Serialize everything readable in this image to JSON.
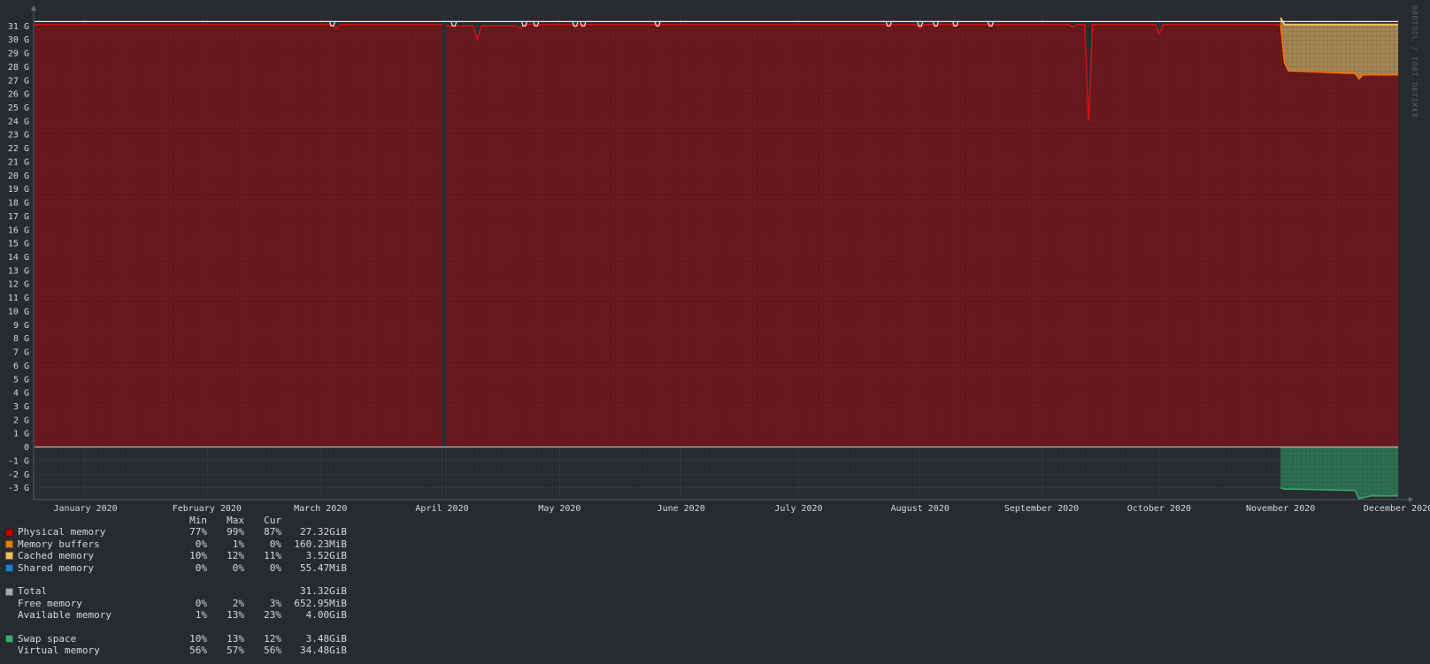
{
  "side_label": "RRDTOOL / TOBI OETIKER",
  "chart_data": {
    "type": "area",
    "title": "",
    "xlabel": "",
    "ylabel": "",
    "y_ticks": [
      "31 G",
      "30 G",
      "29 G",
      "28 G",
      "27 G",
      "26 G",
      "25 G",
      "24 G",
      "23 G",
      "22 G",
      "21 G",
      "20 G",
      "19 G",
      "18 G",
      "17 G",
      "16 G",
      "15 G",
      "14 G",
      "13 G",
      "12 G",
      "11 G",
      "10 G",
      "9 G",
      "8 G",
      "7 G",
      "6 G",
      "5 G",
      "4 G",
      "3 G",
      "2 G",
      "1 G",
      "0",
      "-1 G",
      "-2 G",
      "-3 G"
    ],
    "y_tick_values": [
      31,
      30,
      29,
      28,
      27,
      26,
      25,
      24,
      23,
      22,
      21,
      20,
      19,
      18,
      17,
      16,
      15,
      14,
      13,
      12,
      11,
      10,
      9,
      8,
      7,
      6,
      5,
      4,
      3,
      2,
      1,
      0,
      -1,
      -2,
      -3
    ],
    "ylim": [
      -3.8,
      31.8
    ],
    "x_ticks": [
      "January 2020",
      "February 2020",
      "March 2020",
      "April 2020",
      "May 2020",
      "June 2020",
      "July 2020",
      "August 2020",
      "September 2020",
      "October 2020",
      "November 2020",
      "December 2020"
    ],
    "x_tick_dates": [
      "2020-01-01",
      "2020-02-01",
      "2020-03-01",
      "2020-04-01",
      "2020-05-01",
      "2020-06-01",
      "2020-07-01",
      "2020-08-01",
      "2020-09-01",
      "2020-10-01",
      "2020-11-01",
      "2020-12-01"
    ],
    "xlim": [
      "2019-12-19",
      "2020-12-01"
    ],
    "grid": true,
    "total_gib": 31.32,
    "gap": [
      "2020-04-01",
      "2020-04-02"
    ],
    "cached_start": "2020-11-01",
    "series": [
      {
        "name": "Physical memory",
        "color": "#c00000",
        "x": [
          "2019-12-19",
          "2020-03-04",
          "2020-03-05",
          "2020-03-06",
          "2020-04-01",
          "2020-04-02",
          "2020-04-09",
          "2020-04-10",
          "2020-04-11",
          "2020-04-20",
          "2020-04-21",
          "2020-04-22",
          "2020-05-04",
          "2020-05-05",
          "2020-05-06",
          "2020-07-31",
          "2020-08-01",
          "2020-08-02",
          "2020-09-08",
          "2020-09-09",
          "2020-09-10",
          "2020-09-12",
          "2020-09-13",
          "2020-09-14",
          "2020-09-30",
          "2020-10-01",
          "2020-10-02",
          "2020-11-01",
          "2020-11-02",
          "2020-11-03",
          "2020-11-20",
          "2020-11-21",
          "2020-11-22",
          "2020-12-01"
        ],
        "values": [
          31.1,
          31.1,
          30.8,
          31.1,
          31.1,
          31.0,
          31.0,
          30.0,
          31.0,
          31.0,
          30.8,
          31.1,
          31.1,
          30.9,
          31.1,
          31.1,
          30.8,
          31.1,
          31.1,
          30.9,
          31.1,
          31.1,
          24.0,
          31.1,
          31.1,
          30.4,
          31.1,
          31.1,
          28.3,
          27.7,
          27.5,
          27.1,
          27.4,
          27.4
        ]
      },
      {
        "name": "Cached memory",
        "color": "#f0c060",
        "x": [
          "2020-11-01",
          "2020-11-02",
          "2020-12-01"
        ],
        "values": [
          31.6,
          31.1,
          31.1
        ]
      },
      {
        "name": "Swap space",
        "color": "#3caa6e",
        "x": [
          "2020-11-01",
          "2020-11-02",
          "2020-11-05",
          "2020-11-20",
          "2020-11-21",
          "2020-11-24",
          "2020-12-01"
        ],
        "values": [
          -3.0,
          -3.1,
          -3.1,
          -3.2,
          -3.8,
          -3.6,
          -3.6
        ]
      }
    ],
    "total_line": {
      "name": "Total",
      "color": "#e8e8e8",
      "value": 31.32
    },
    "total_dips": [
      "2020-03-04",
      "2020-04-04",
      "2020-04-22",
      "2020-04-25",
      "2020-05-05",
      "2020-05-07",
      "2020-05-26",
      "2020-07-24",
      "2020-08-01",
      "2020-08-05",
      "2020-08-10",
      "2020-08-19"
    ]
  },
  "legend": {
    "header": {
      "min": "Min",
      "max": "Max",
      "cur": "Cur"
    },
    "rows": [
      {
        "name": "Physical memory",
        "color": "#c00000",
        "min": "77%",
        "max": "99%",
        "cur": "87%",
        "value": "27.32GiB"
      },
      {
        "name": "Memory buffers",
        "color": "#e08010",
        "min": "0%",
        "max": "1%",
        "cur": "0%",
        "value": "160.23MiB"
      },
      {
        "name": "Cached memory",
        "color": "#f0c060",
        "min": "10%",
        "max": "12%",
        "cur": "11%",
        "value": "3.52GiB"
      },
      {
        "name": "Shared memory",
        "color": "#1a80d0",
        "min": "0%",
        "max": "0%",
        "cur": "0%",
        "value": "55.47MiB"
      },
      {
        "blank": true
      },
      {
        "name": "Total",
        "color": "#a8a8a8",
        "min": "",
        "max": "",
        "cur": "",
        "value": "31.32GiB"
      },
      {
        "name": "Free memory",
        "color": "",
        "min": "0%",
        "max": "2%",
        "cur": "3%",
        "value": "652.95MiB"
      },
      {
        "name": "Available memory",
        "color": "",
        "min": "1%",
        "max": "13%",
        "cur": "23%",
        "value": "4.00GiB"
      },
      {
        "blank": true
      },
      {
        "name": "Swap space",
        "color": "#3caa6e",
        "min": "10%",
        "max": "13%",
        "cur": "12%",
        "value": "3.48GiB"
      },
      {
        "name": "Virtual memory",
        "color": "",
        "min": "56%",
        "max": "57%",
        "cur": "56%",
        "value": "34.48GiB"
      }
    ]
  }
}
